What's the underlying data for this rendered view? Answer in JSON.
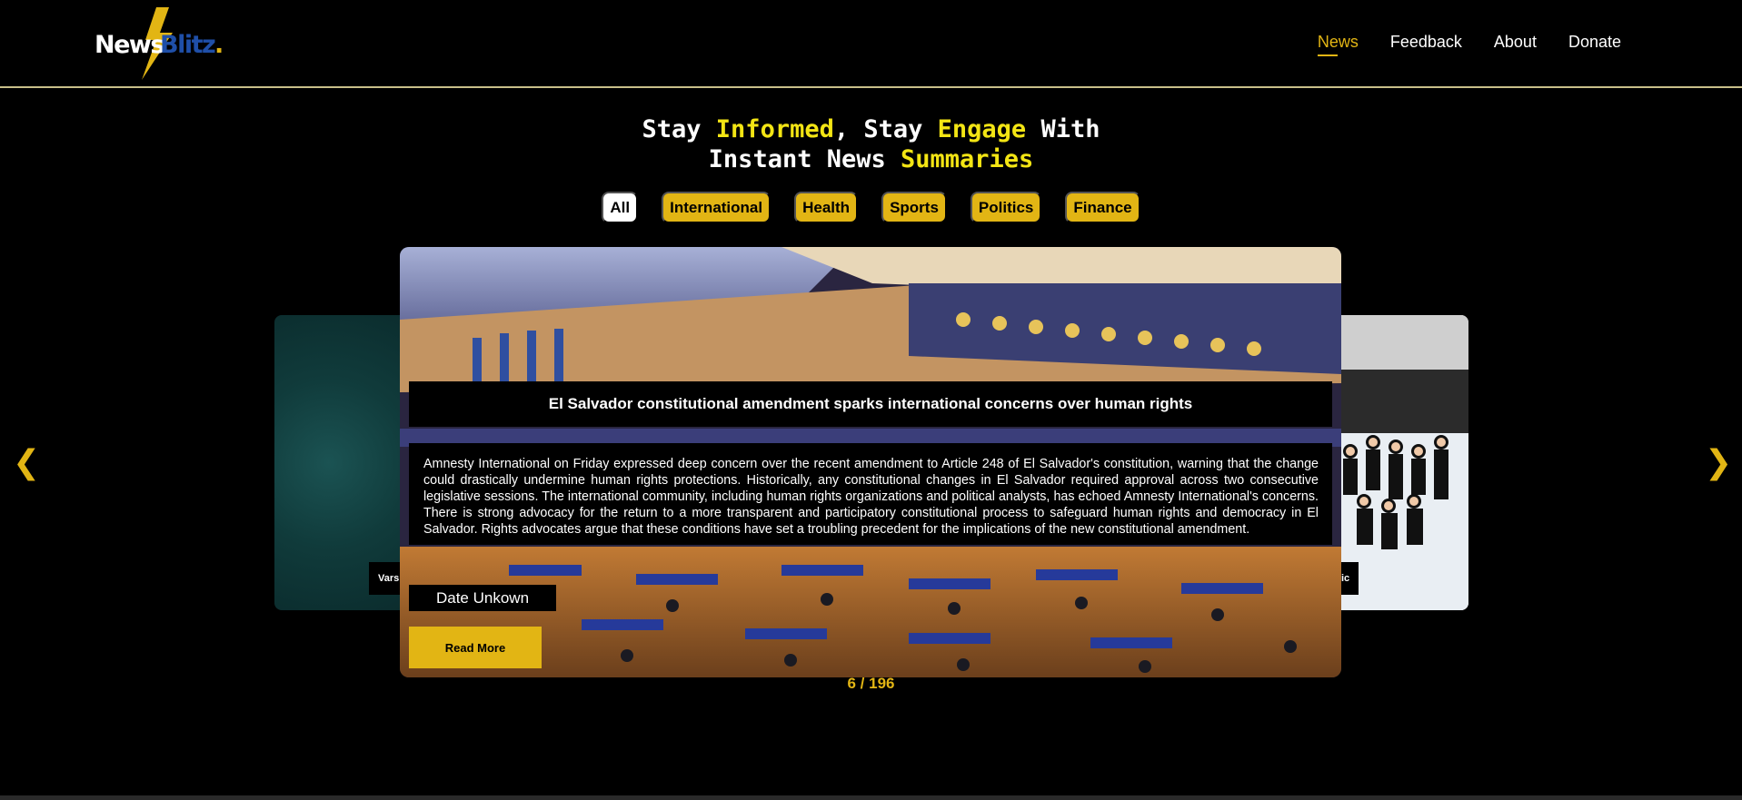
{
  "brand": {
    "word1": "News",
    "word2": "Blitz",
    "dot": "."
  },
  "nav": [
    {
      "label": "News",
      "active": true
    },
    {
      "label": "Feedback"
    },
    {
      "label": "About"
    },
    {
      "label": "Donate"
    }
  ],
  "headline": {
    "p1": "Stay ",
    "h1": "Informed",
    "p2": ", Stay ",
    "h2": "Engage",
    "p3": " With",
    "p4": "Instant News ",
    "h3": "Summaries"
  },
  "categories": [
    {
      "label": "All",
      "active": true
    },
    {
      "label": "International"
    },
    {
      "label": "Health"
    },
    {
      "label": "Sports"
    },
    {
      "label": "Politics"
    },
    {
      "label": "Finance"
    }
  ],
  "carousel": {
    "prev_tag": "Vars",
    "next_tag": "ic",
    "current": {
      "title": "El Salvador constitutional amendment sparks international concerns over human rights",
      "summary": "Amnesty International on Friday expressed deep concern over the recent amendment to Article 248 of El Salvador's constitution, warning that the change could drastically undermine human rights protections. Historically, any constitutional changes in El Salvador required approval across two consecutive legislative sessions. The international community, including human rights organizations and political analysts, has echoed Amnesty International's concerns. There is strong advocacy for the return to a more transparent and participatory constitutional process to safeguard human rights and democracy in El Salvador. Rights advocates argue that these conditions have set a troubling precedent for the implications of the new constitutional amendment.",
      "date": "Date Unkown",
      "read_more": "Read More"
    },
    "counter": "6 / 196",
    "prev_arrow": "❮",
    "next_arrow": "❯"
  },
  "colors": {
    "accent": "#e2b514",
    "highlight": "#f3e514",
    "brand_blue": "#1f4fa8"
  }
}
